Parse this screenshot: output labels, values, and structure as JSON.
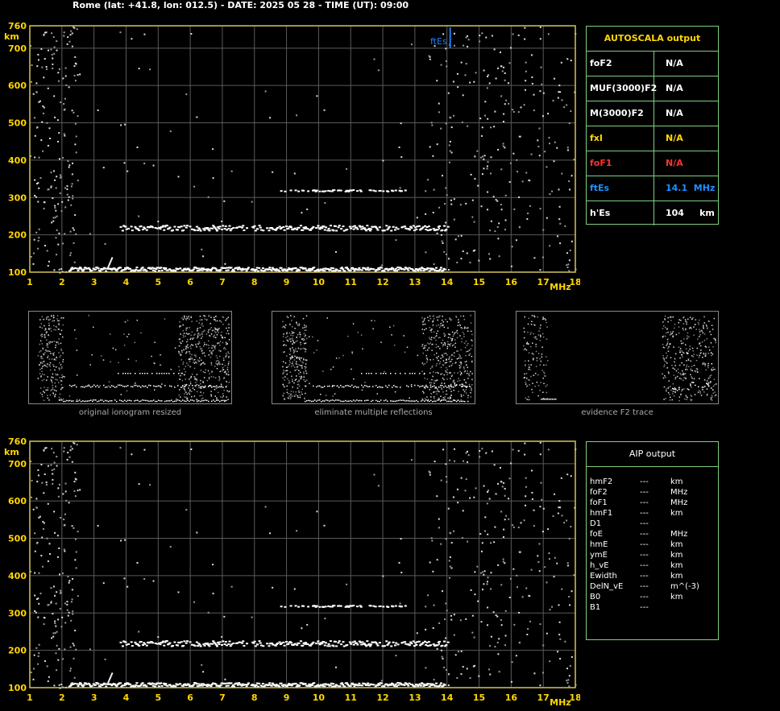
{
  "header": {
    "title": "Rome (lat: +41.8, lon: 012.5) - DATE: 2025 05 28 - TIME (UT): 09:00"
  },
  "colors": {
    "axis_label": "#ffd700",
    "grid": "#5a5a5a",
    "frame": "#d6c45a",
    "table_border": "#7fcf7f",
    "ftes": "#1e7fff",
    "fof1": "#ff3030"
  },
  "autoscala": {
    "title": "AUTOSCALA output",
    "rows": [
      {
        "key": "foF2",
        "value": "N/A",
        "color": "#ffffff"
      },
      {
        "key": "MUF(3000)F2",
        "value": "N/A",
        "color": "#ffffff"
      },
      {
        "key": "M(3000)F2",
        "value": "N/A",
        "color": "#ffffff"
      },
      {
        "key": "fxI",
        "value": "N/A",
        "color": "#ffd700"
      },
      {
        "key": "foF1",
        "value": "N/A",
        "color": "#ff3030"
      },
      {
        "key": "ftEs",
        "value": "14.1  MHz",
        "color": "#1e90ff"
      },
      {
        "key": "h'Es",
        "value": "104     km",
        "color": "#ffffff"
      }
    ]
  },
  "aip": {
    "title": "AIP output",
    "rows": [
      {
        "k": "hmF2",
        "v": "---",
        "u": "km"
      },
      {
        "k": "foF2",
        "v": "---",
        "u": "MHz"
      },
      {
        "k": "foF1",
        "v": "---",
        "u": "MHz"
      },
      {
        "k": "hmF1",
        "v": "---",
        "u": "km"
      },
      {
        "k": "D1",
        "v": "---",
        "u": ""
      },
      {
        "k": "foE",
        "v": "---",
        "u": "MHz"
      },
      {
        "k": "hmE",
        "v": "---",
        "u": "km"
      },
      {
        "k": "ymE",
        "v": "---",
        "u": "km"
      },
      {
        "k": "h_vE",
        "v": "---",
        "u": "km"
      },
      {
        "k": "Ewidth",
        "v": "---",
        "u": "km"
      },
      {
        "k": "DelN_vE",
        "v": "---",
        "u": "m^(-3)"
      },
      {
        "k": "B0",
        "v": "---",
        "u": "km"
      },
      {
        "k": "B1",
        "v": "---",
        "u": ""
      }
    ]
  },
  "thumbnails": {
    "captions": [
      "original ionogram resized",
      "eliminate multiple reflections",
      "evidence F2 trace"
    ]
  },
  "chart_data": [
    {
      "type": "scatter",
      "name": "ionogram-autoscala",
      "xlim": [
        1,
        18
      ],
      "ylim": [
        100,
        760
      ],
      "xticks": [
        1,
        2,
        3,
        4,
        5,
        6,
        7,
        8,
        9,
        10,
        11,
        12,
        13,
        14,
        15,
        16,
        17,
        18
      ],
      "yticks": [
        100,
        200,
        300,
        400,
        500,
        600,
        700,
        760
      ],
      "xunit": "MHz",
      "yunit": "km",
      "ftEs_marker": {
        "label": "ftEs",
        "x": 14.1
      },
      "traces": [
        {
          "name": "Es",
          "x_start": 2.2,
          "x_end": 13.9,
          "y": 110
        },
        {
          "name": "cusp",
          "x": 3.4,
          "y": 130
        },
        {
          "name": "2Es",
          "x_start": 3.8,
          "x_end": 14.0,
          "y": 220
        },
        {
          "name": "3Es",
          "x_start": 8.8,
          "x_end": 12.7,
          "y": 320
        }
      ]
    },
    {
      "type": "scatter",
      "name": "ionogram-aip",
      "xlim": [
        1,
        18
      ],
      "ylim": [
        100,
        760
      ],
      "xticks": [
        1,
        2,
        3,
        4,
        5,
        6,
        7,
        8,
        9,
        10,
        11,
        12,
        13,
        14,
        15,
        16,
        17,
        18
      ],
      "yticks": [
        100,
        200,
        300,
        400,
        500,
        600,
        700,
        760
      ],
      "xunit": "MHz",
      "yunit": "km"
    }
  ]
}
